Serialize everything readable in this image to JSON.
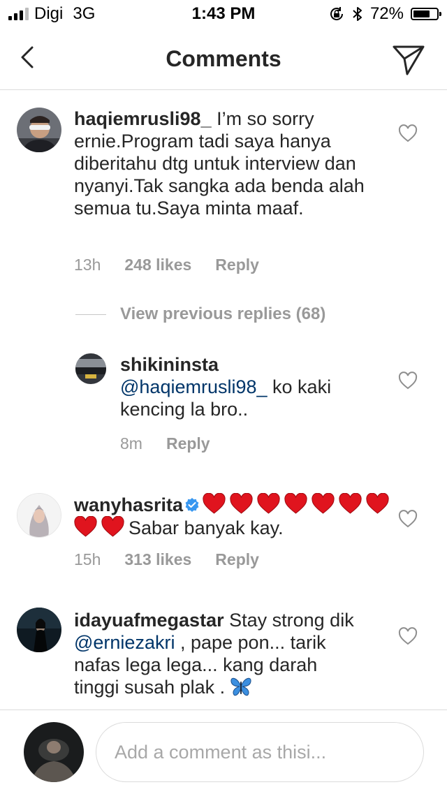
{
  "status_bar": {
    "carrier": "Digi",
    "network": "3G",
    "time": "1:43 PM",
    "battery_percent_text": "72%",
    "battery_level": 0.72,
    "signal_bars_active": 3,
    "signal_bars_total": 4
  },
  "nav": {
    "title": "Comments",
    "back_icon": "chevron-left-icon",
    "share_icon": "paper-plane-icon"
  },
  "comments": [
    {
      "username": "haqiemrusli98_",
      "text": "I’m so sorry ernie.Program tadi saya hanya diberitahu dtg untuk interview dan nyanyi.Tak sangka ada benda alah semua tu.Saya minta maaf.",
      "time": "13h",
      "likes": "248 likes",
      "reply": "Reply"
    },
    {
      "username": "wanyhasrita",
      "text": "Sabar banyak kay.",
      "heart_count": 9,
      "time": "15h",
      "likes": "313 likes",
      "reply": "Reply"
    },
    {
      "username": "idayuafmegastar",
      "text_before": "Stay strong dik",
      "mention": "@erniezakri",
      "text_after": ", pape pon... tarik nafas lega lega... kang darah tinggi susah plak .",
      "emoji": "butterfly-emoji"
    }
  ],
  "view_previous": "View previous replies (68)",
  "replies": [
    {
      "username": "shikininsta",
      "mention": "@haqiemrusli98_",
      "text": "ko kaki kencing la bro..",
      "time": "8m",
      "reply": "Reply"
    }
  ],
  "comment_box": {
    "placeholder": "Add a comment as thisi..."
  },
  "colors": {
    "text": "#262626",
    "meta": "#999999",
    "mention": "#003569",
    "divider": "#dbdbdb",
    "verified": "#3897f0",
    "emoji_heart": "#e0141e",
    "butterfly": "#3b8fe0"
  }
}
